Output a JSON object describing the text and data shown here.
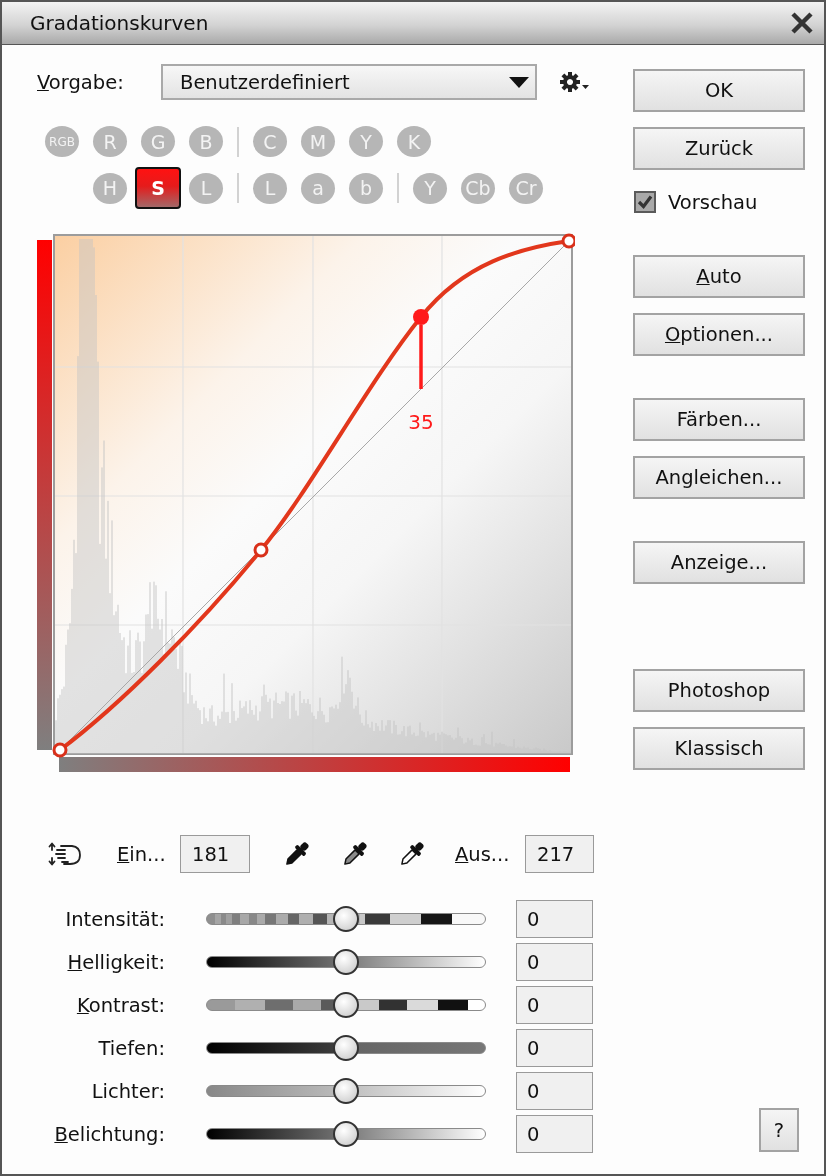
{
  "window": {
    "title": "Gradationskurven"
  },
  "preset": {
    "label": "Vorgabe:",
    "mnemonic": true,
    "value": "Benutzerdefiniert"
  },
  "channel_rows": [
    [
      {
        "kind": "channel",
        "label": "RGB",
        "selected": false
      },
      {
        "kind": "channel",
        "label": "R",
        "selected": false
      },
      {
        "kind": "channel",
        "label": "G",
        "selected": false
      },
      {
        "kind": "channel",
        "label": "B",
        "selected": false
      },
      {
        "kind": "separator"
      },
      {
        "kind": "channel",
        "label": "C",
        "selected": false
      },
      {
        "kind": "channel",
        "label": "M",
        "selected": false
      },
      {
        "kind": "channel",
        "label": "Y",
        "selected": false
      },
      {
        "kind": "channel",
        "label": "K",
        "selected": false
      }
    ],
    [
      {
        "kind": "channel",
        "label": "H",
        "selected": false
      },
      {
        "kind": "channel",
        "label": "S",
        "selected": true
      },
      {
        "kind": "channel",
        "label": "L",
        "selected": false
      },
      {
        "kind": "separator"
      },
      {
        "kind": "channel",
        "label": "L",
        "selected": false
      },
      {
        "kind": "channel",
        "label": "a",
        "selected": false
      },
      {
        "kind": "channel",
        "label": "b",
        "selected": false
      },
      {
        "kind": "separator"
      },
      {
        "kind": "channel",
        "label": "Y",
        "selected": false
      },
      {
        "kind": "channel",
        "label": "Cb",
        "selected": false
      },
      {
        "kind": "channel",
        "label": "Cr",
        "selected": false
      }
    ]
  ],
  "curve": {
    "points": [
      {
        "selected": false
      },
      {
        "selected": false
      },
      {
        "selected": true
      },
      {
        "selected": false
      }
    ],
    "offset_label": "35"
  },
  "input": {
    "label": "Ein...",
    "mnemonic": true,
    "value": "181"
  },
  "output": {
    "label": "Aus...",
    "mnemonic": true,
    "value": "217"
  },
  "sliders": [
    {
      "kind": "intensity",
      "label": "Intensität:",
      "mnemonic": false,
      "level": 0.5,
      "value": "0"
    },
    {
      "kind": "brightness",
      "label": "Helligkeit:",
      "mnemonic": true,
      "level": 0.5,
      "value": "0"
    },
    {
      "kind": "contrast",
      "label": "Kontrast:",
      "mnemonic": true,
      "level": 0.5,
      "value": "0"
    },
    {
      "kind": "shadows",
      "label": "Tiefen:",
      "mnemonic": false,
      "level": 0.5,
      "value": "0"
    },
    {
      "kind": "highlights",
      "label": "Lichter:",
      "mnemonic": false,
      "level": 0.5,
      "value": "0"
    },
    {
      "kind": "exposure",
      "label": "Belichtung:",
      "mnemonic": true,
      "level": 0.5,
      "value": "0"
    }
  ],
  "button_groups": [
    [
      {
        "kind": "button",
        "label": "OK",
        "mnemonic": false
      },
      {
        "kind": "button",
        "label": "Zurück",
        "mnemonic": false
      },
      {
        "kind": "checkbox",
        "label": "Vorschau",
        "checked": true
      }
    ],
    [
      {
        "kind": "button",
        "label": "Auto",
        "mnemonic": true
      },
      {
        "kind": "button",
        "label": "Optionen...",
        "mnemonic": true
      }
    ],
    [
      {
        "kind": "button",
        "label": "Färben...",
        "mnemonic": false
      },
      {
        "kind": "button",
        "label": "Angleichen...",
        "mnemonic": false
      }
    ],
    [
      {
        "kind": "button",
        "label": "Anzeige...",
        "mnemonic": false
      }
    ],
    [
      {
        "kind": "button",
        "label": "Photoshop",
        "mnemonic": false
      },
      {
        "kind": "button",
        "label": "Klassisch",
        "mnemonic": false
      }
    ]
  ],
  "help": {
    "label": "?"
  }
}
